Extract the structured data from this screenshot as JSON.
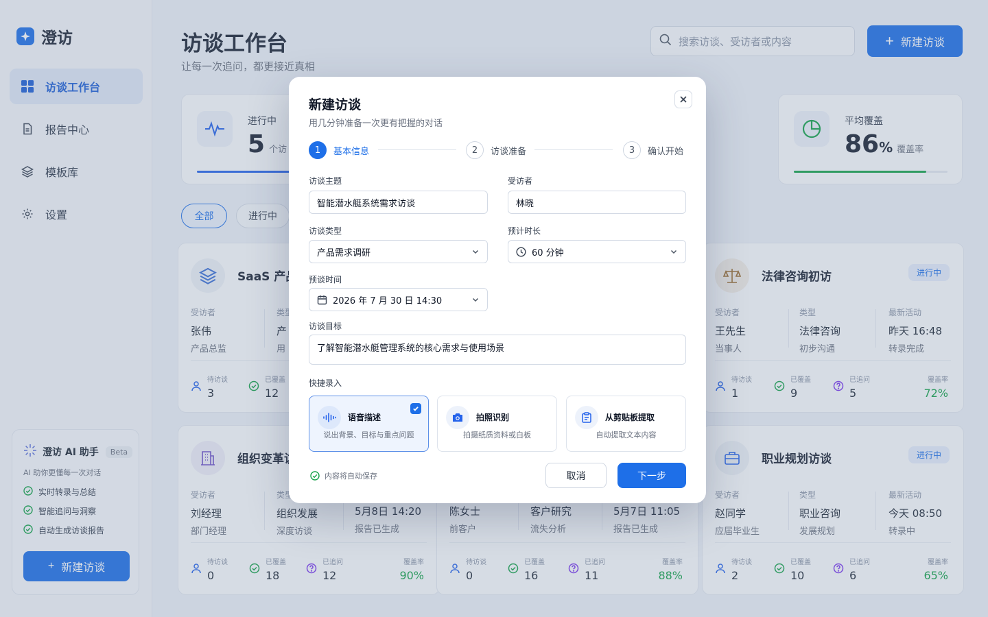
{
  "app": {
    "name": "澄访"
  },
  "nav": [
    {
      "label": "访谈工作台",
      "icon": "grid-icon",
      "active": true
    },
    {
      "label": "报告中心",
      "icon": "document-icon",
      "active": false
    },
    {
      "label": "模板库",
      "icon": "layers-icon",
      "active": false
    },
    {
      "label": "设置",
      "icon": "gear-icon",
      "active": false
    }
  ],
  "assistant": {
    "title": "澄访 AI 助手",
    "badge": "Beta",
    "desc": "AI 助你更懂每一次对话",
    "features": [
      "实时转录与总结",
      "智能追问与洞察",
      "自动生成访谈报告"
    ],
    "button": "新建访谈"
  },
  "header": {
    "title": "访谈工作台",
    "subtitle": "让每一次追问，都更接近真相",
    "search_placeholder": "搜索访谈、受访者或内容",
    "new_button": "新建访谈"
  },
  "stats": [
    {
      "label": "进行中",
      "value": "5",
      "unit": "个访"
    },
    {
      "label": "平均覆盖",
      "value": "86",
      "suffix": "%",
      "unit": "覆盖率",
      "progress": 0.86
    }
  ],
  "filters": [
    "全部",
    "进行中"
  ],
  "cards": [
    {
      "title": "SaaS 产品",
      "icon": "layers-icon",
      "interviewee_label": "受访者",
      "interviewee": "张伟",
      "role": "产品总监",
      "type_label": "类型",
      "type_main": "产",
      "type_sub": "用",
      "pending": "3",
      "covered": "12"
    },
    {
      "title": "法律咨询初访",
      "icon": "scale-icon",
      "badge": "进行中",
      "interviewee_label": "受访者",
      "interviewee": "王先生",
      "role": "当事人",
      "type_label": "类型",
      "type_main": "法律咨询",
      "type_sub": "初步沟通",
      "activity_label": "最新活动",
      "activity": "昨天 16:48",
      "activity_sub": "转录完成",
      "pending": "1",
      "covered": "9",
      "followed": "5",
      "rate": "72%"
    },
    {
      "title": "组织变革访",
      "icon": "building-icon",
      "interviewee_label": "受访者",
      "interviewee": "刘经理",
      "role": "部门经理",
      "type_label": "类型",
      "type_main": "组织发展",
      "type_sub": "深度访谈",
      "activity": "5月8日 14:20",
      "activity_sub": "报告已生成",
      "pending": "0",
      "covered": "18",
      "followed": "12",
      "rate": "90%"
    },
    {
      "title": "",
      "interviewee": "陈女士",
      "role": "前客户",
      "type_main": "客户研究",
      "type_sub": "流失分析",
      "activity": "5月7日 11:05",
      "activity_sub": "报告已生成",
      "pending": "0",
      "covered": "16",
      "followed": "11",
      "rate": "88%"
    },
    {
      "title": "职业规划访谈",
      "icon": "briefcase-icon",
      "badge": "进行中",
      "interviewee_label": "受访者",
      "interviewee": "赵同学",
      "role": "应届毕业生",
      "type_label": "类型",
      "type_main": "职业咨询",
      "type_sub": "发展规划",
      "activity_label": "最新活动",
      "activity": "今天 08:50",
      "activity_sub": "转录中",
      "pending": "2",
      "covered": "10",
      "followed": "6",
      "rate": "65%"
    }
  ],
  "metric_labels": {
    "pending": "待访谈",
    "covered": "已覆盖",
    "followed": "已追问",
    "rate": "覆盖率"
  },
  "modal": {
    "title": "新建访谈",
    "subtitle": "用几分钟准备一次更有把握的对话",
    "steps": [
      {
        "num": "1",
        "label": "基本信息",
        "active": true
      },
      {
        "num": "2",
        "label": "访谈准备",
        "active": false
      },
      {
        "num": "3",
        "label": "确认开始",
        "active": false
      }
    ],
    "fields": {
      "topic_label": "访谈主题",
      "topic": "智能潜水艇系统需求访谈",
      "interviewee_label": "受访者",
      "interviewee": "林晓",
      "type_label": "访谈类型",
      "type": "产品需求调研",
      "duration_label": "预计时长",
      "duration": "60 分钟",
      "time_label": "预谈时间",
      "time": "2026 年 7 月 30 日 14:30",
      "goal_label": "访谈目标",
      "goal": "了解智能潜水艇管理系统的核心需求与使用场景"
    },
    "quick_label": "快捷录入",
    "quick": [
      {
        "title": "语音描述",
        "desc": "说出背景、目标与重点问题",
        "icon": "waveform-icon",
        "selected": true
      },
      {
        "title": "拍照识别",
        "desc": "拍摄纸质资料或白板",
        "icon": "camera-icon",
        "selected": false
      },
      {
        "title": "从剪贴板提取",
        "desc": "自动提取文本内容",
        "icon": "clipboard-icon",
        "selected": false
      }
    ],
    "autosave": "内容将自动保存",
    "cancel": "取消",
    "next": "下一步"
  },
  "colors": {
    "primary": "#1e6fe8",
    "success": "#16a34a"
  }
}
